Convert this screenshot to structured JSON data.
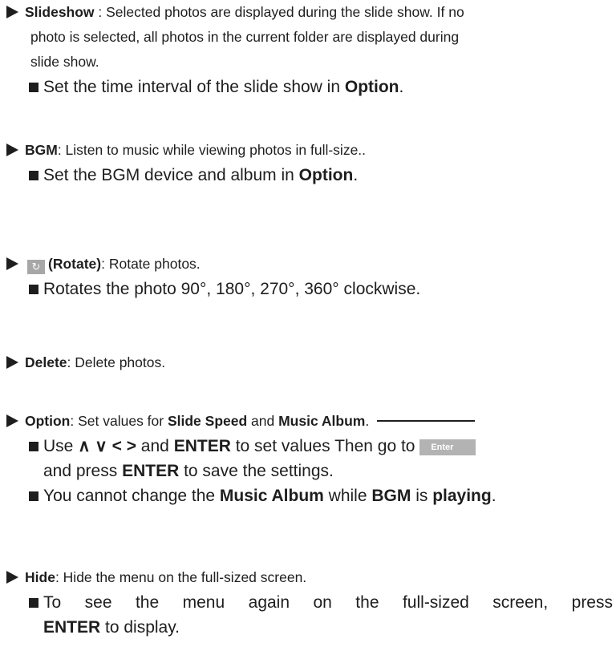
{
  "slideshow": {
    "title": "Slideshow",
    "desc1": " : Selected photos are displayed during the slide show. If no",
    "desc2": "photo is selected, all photos in the current folder are displayed during",
    "desc3": "slide show.",
    "sub1_pre": "Set the time interval of the slide show in ",
    "sub1_bold": "Option",
    "sub1_post": "."
  },
  "bgm": {
    "title": "BGM",
    "desc": ": Listen to music while viewing photos in full-size..",
    "sub1_pre": "Set the BGM device and album in ",
    "sub1_bold": "Option",
    "sub1_post": "."
  },
  "rotate": {
    "icon_glyph": "↻",
    "title": "(Rotate)",
    "desc": ": Rotate photos.",
    "sub1": "Rotates the photo 90°, 180°, 270°, 360° clockwise."
  },
  "delete": {
    "title": "Delete",
    "desc": ": Delete photos."
  },
  "option": {
    "title": "Option",
    "desc1": ": Set values for ",
    "bold1": "Slide Speed",
    "desc2": " and ",
    "bold2": "Music Album",
    "desc3": ".",
    "sub1_pre": "Use ",
    "sub1_keys": "∧ ∨  <  >",
    "sub1_mid": " and ",
    "sub1_bold": "ENTER",
    "sub1_post": " to set values Then go to ",
    "enter_button": "Enter",
    "sub1_line2_pre": "and press ",
    "sub1_line2_bold": "ENTER",
    "sub1_line2_post": " to save the settings.",
    "sub2_pre": "You cannot change the ",
    "sub2_bold1": "Music Album",
    "sub2_mid": " while ",
    "sub2_bold2": "BGM",
    "sub2_mid2": " is ",
    "sub2_bold3": "playing",
    "sub2_post": "."
  },
  "hide": {
    "title": "Hide",
    "desc": ": Hide the menu on the full-sized screen.",
    "sub1": "To see the menu again on the full-sized screen, press",
    "sub1_line2_bold": "ENTER",
    "sub1_line2_post": " to display."
  }
}
